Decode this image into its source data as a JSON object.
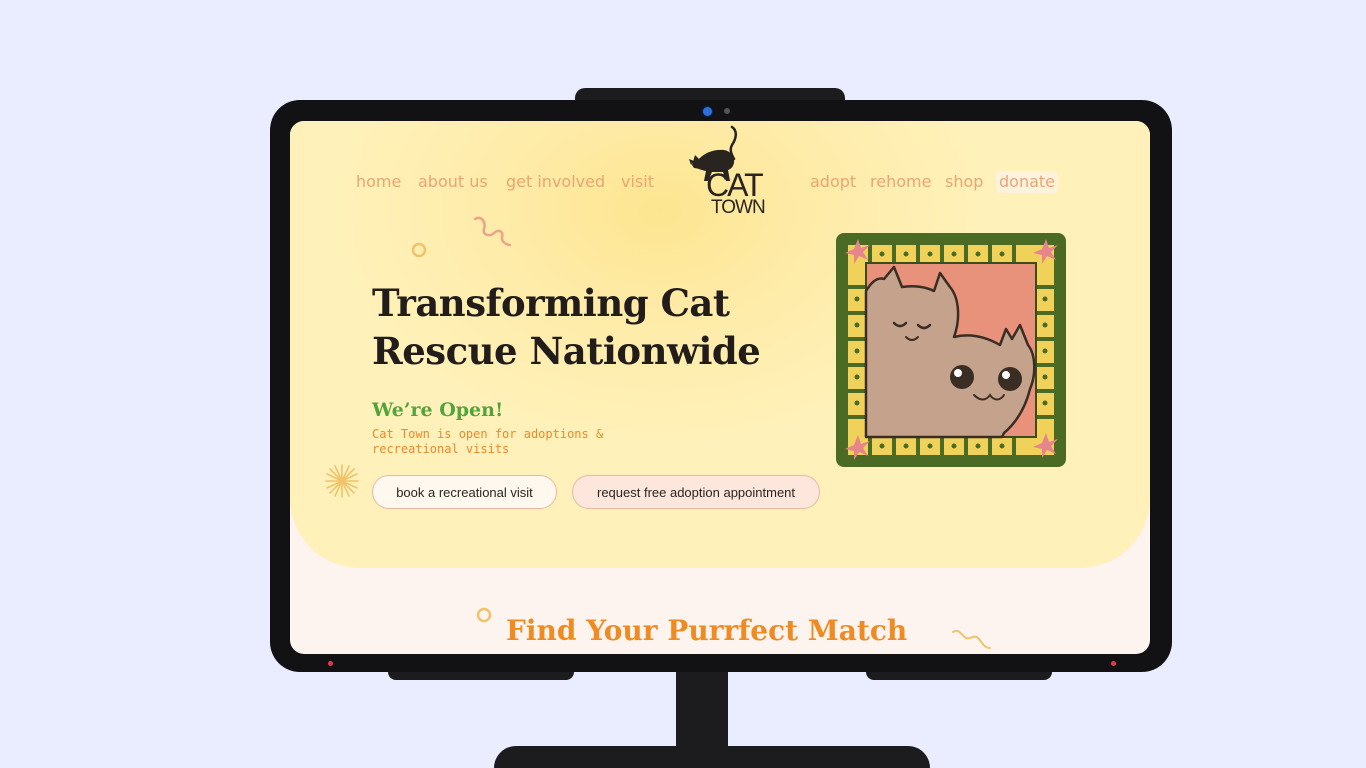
{
  "nav": {
    "left": [
      "home",
      "about us",
      "get involved",
      "visit"
    ],
    "right": [
      "adopt",
      "rehome",
      "shop",
      "donate"
    ]
  },
  "logo": {
    "line1": "CAT",
    "line2": "TOWN"
  },
  "hero": {
    "title_line1": "Transforming Cat",
    "title_line2": "Rescue Nationwide",
    "open_title": "We’re Open!",
    "open_text": "Cat Town is open for adoptions & recreational visits",
    "buttons": {
      "visit": "book a recreational visit",
      "adopt": "request free adoption appointment"
    }
  },
  "match": {
    "title": "Find Your Purrfect Match"
  },
  "colors": {
    "background": "#eaedff",
    "hero": "#fff1b9",
    "nav_text": "#eca474",
    "title": "#221d1b",
    "open_green": "#51a43c",
    "accent_orange": "#f08b22",
    "page_bottom": "#fdf3ef"
  },
  "icons": [
    "cat-silhouette-icon",
    "squiggle-icon",
    "circle-icon",
    "sunburst-icon",
    "sparkle-icon"
  ]
}
